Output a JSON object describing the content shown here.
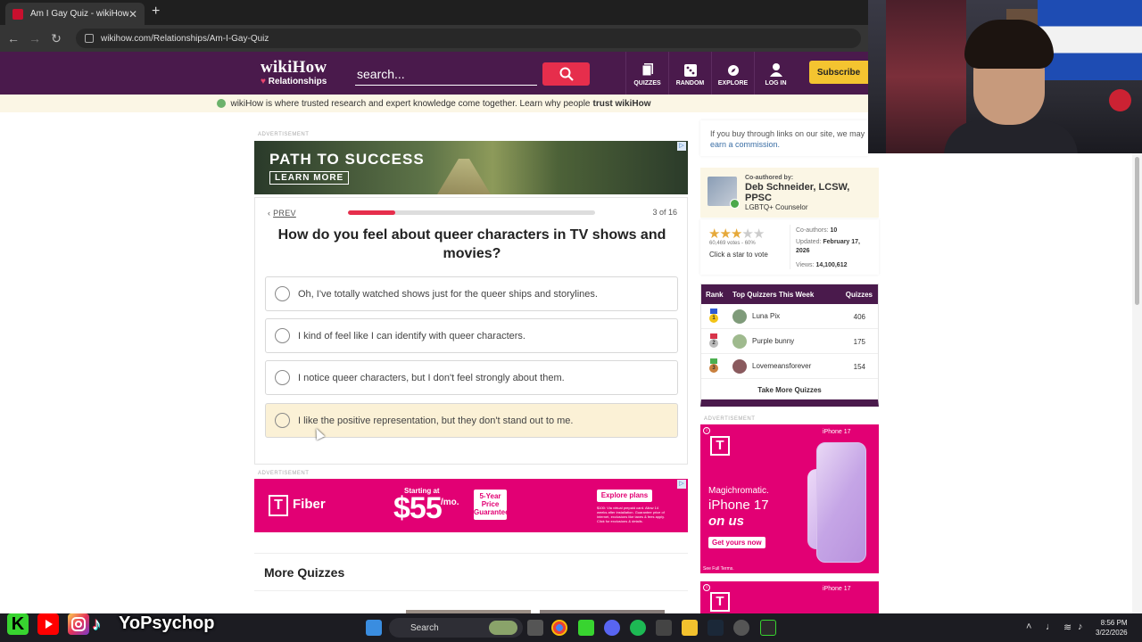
{
  "browser": {
    "tab_title": "Am I Gay Quiz - wikiHow",
    "url": "wikihow.com/Relationships/Am-I-Gay-Quiz"
  },
  "site": {
    "logo_main": "wikiHow",
    "logo_sub": "Relationships",
    "search_placeholder": "search...",
    "nav": [
      {
        "label": "QUIZZES",
        "icon": "quizzes-icon"
      },
      {
        "label": "RANDOM",
        "icon": "dice-icon"
      },
      {
        "label": "EXPLORE",
        "icon": "compass-icon"
      },
      {
        "label": "LOG IN",
        "icon": "user-icon"
      }
    ],
    "subscribe": "Subscribe",
    "trust_text": "wikiHow is where trusted research and expert knowledge come together. Learn why people",
    "trust_bold": "trust wikiHow",
    "colors": {
      "header": "#4a1a4c",
      "accent": "#e62e4c",
      "subscribe": "#f4c430"
    }
  },
  "ads": {
    "label": "ADVERTISEMENT",
    "top_banner": {
      "headline": "PATH TO SUCCESS",
      "cta": "LEARN MORE"
    },
    "fiber": {
      "brand": "Fiber",
      "starting": "Starting at",
      "price": "$55",
      "per": "/mo.",
      "guarantee": "5-Year Price Guarantee",
      "cta": "Explore plans",
      "fine": "$100: Via virtual prepaid card. Allow 14 weeks after installation. Guarantee price of internet, exclusions like taxes & fees apply. Click for exclusions & details."
    },
    "iphone": {
      "brand_sub": "iPhone 17",
      "line1": "Magichromatic.",
      "line2": "iPhone 17",
      "line3": "on us",
      "cta": "Get yours now",
      "terms": "See Full Terms."
    }
  },
  "quiz": {
    "prev": "PREV",
    "progress": 0.19,
    "counter": "3 of 16",
    "question": "How do you feel about queer characters in TV shows and movies?",
    "options": [
      "Oh, I've totally watched shows just for the queer ships and storylines.",
      "I kind of feel like I can identify with queer characters.",
      "I notice queer characters, but I don't feel strongly about them.",
      "I like the positive representation, but they don't stand out to me."
    ]
  },
  "more_quizzes": {
    "heading": "More Quizzes"
  },
  "sidebar": {
    "disclaimer": "If you buy through links on our site, we may",
    "disclaimer_link": "earn a commission.",
    "coauthored_label": "Co-authored by:",
    "author_name": "Deb Schneider, LCSW, PPSC",
    "author_role": "LGBTQ+ Counselor",
    "rating": {
      "stars": 3,
      "max": 5,
      "votes": "60,469 votes - 60%",
      "click": "Click a star to vote"
    },
    "meta": {
      "coauthors_label": "Co-authors:",
      "coauthors": "10",
      "updated_label": "Updated:",
      "updated": "February 17, 2026",
      "views_label": "Views:",
      "views": "14,100,612"
    },
    "leaderboard": {
      "headers": {
        "rank": "Rank",
        "title": "Top Quizzers This Week",
        "score": "Quizzes"
      },
      "rows": [
        {
          "rank": "1",
          "name": "Luna Pix",
          "score": "406"
        },
        {
          "rank": "2",
          "name": "Purple bunny",
          "score": "175"
        },
        {
          "rank": "3",
          "name": "Lovemeansforever",
          "score": "154"
        }
      ],
      "more": "Take More Quizzes"
    }
  },
  "overlay": {
    "channel": "YoPsychop"
  },
  "taskbar": {
    "search": "Search",
    "time": "8:56 PM",
    "date": "3/22/2026"
  }
}
